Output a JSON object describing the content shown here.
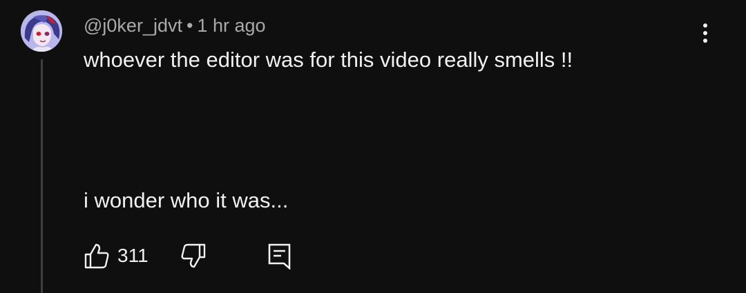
{
  "comment": {
    "author": "@j0ker_jdvt",
    "separator": "•",
    "timestamp": "1 hr ago",
    "text_line1": "whoever the editor was for this video really smells !!",
    "text_line2": "i wonder who it was...",
    "likes": "311"
  },
  "icons": {
    "like": "thumbs-up-icon",
    "dislike": "thumbs-down-icon",
    "reply": "comment-reply-icon",
    "more": "more-vertical-icon"
  },
  "colors": {
    "background": "#0f0f0f",
    "text_primary": "#f1f1f1",
    "text_secondary": "#aaaaaa",
    "thread_line": "#3f3f3f",
    "avatar_bg": "#b7b4ea"
  }
}
